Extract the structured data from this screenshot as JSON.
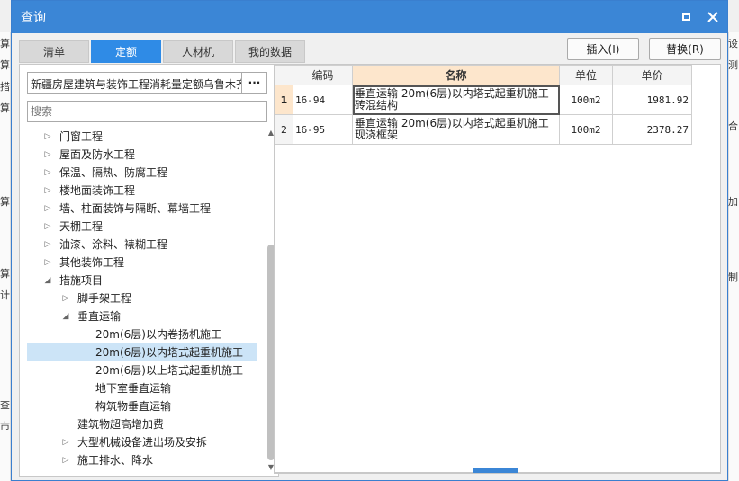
{
  "background": {
    "left_marks": [
      "算",
      "算",
      "措",
      "算",
      "算",
      "算",
      "计",
      "查",
      "市"
    ],
    "right_marks": [
      "设",
      "测",
      "合",
      "加",
      "制"
    ]
  },
  "window": {
    "title": "查询",
    "maximize_icon": "maximize-icon",
    "close_icon": "close-icon"
  },
  "tabs": [
    "清单",
    "定额",
    "人材机",
    "我的数据"
  ],
  "active_tab": "定额",
  "toolbar": {
    "insert_label": "插入(I)",
    "replace_label": "替换(R)"
  },
  "left": {
    "quota_db": "新疆房屋建筑与装饰工程消耗量定额乌鲁木齐",
    "more_label": "···",
    "search_placeholder": "搜索",
    "tree": [
      {
        "label": "门窗工程",
        "level": 1,
        "arrow": "right"
      },
      {
        "label": "屋面及防水工程",
        "level": 1,
        "arrow": "right"
      },
      {
        "label": "保温、隔热、防腐工程",
        "level": 1,
        "arrow": "right"
      },
      {
        "label": "楼地面装饰工程",
        "level": 1,
        "arrow": "right"
      },
      {
        "label": "墙、柱面装饰与隔断、幕墙工程",
        "level": 1,
        "arrow": "right"
      },
      {
        "label": "天棚工程",
        "level": 1,
        "arrow": "right"
      },
      {
        "label": "油漆、涂料、裱糊工程",
        "level": 1,
        "arrow": "right"
      },
      {
        "label": "其他装饰工程",
        "level": 1,
        "arrow": "right"
      },
      {
        "label": "措施项目",
        "level": 1,
        "arrow": "down"
      },
      {
        "label": "脚手架工程",
        "level": 2,
        "arrow": "right"
      },
      {
        "label": "垂直运输",
        "level": 2,
        "arrow": "down"
      },
      {
        "label": "20m(6层)以内卷扬机施工",
        "level": 3,
        "arrow": ""
      },
      {
        "label": "20m(6层)以内塔式起重机施工",
        "level": 3,
        "arrow": "",
        "selected": true
      },
      {
        "label": "20m(6层)以上塔式起重机施工",
        "level": 3,
        "arrow": ""
      },
      {
        "label": "地下室垂直运输",
        "level": 3,
        "arrow": ""
      },
      {
        "label": "构筑物垂直运输",
        "level": 3,
        "arrow": ""
      },
      {
        "label": "建筑物超高增加费",
        "level": 2,
        "arrow": ""
      },
      {
        "label": "大型机械设备进出场及安拆",
        "level": 2,
        "arrow": "right"
      },
      {
        "label": "施工排水、降水",
        "level": 2,
        "arrow": "right"
      }
    ]
  },
  "grid": {
    "headers": [
      "编码",
      "名称",
      "单位",
      "单价"
    ],
    "rows": [
      {
        "no": "1",
        "code": "16-94",
        "name": "垂直运输 20m(6层)以内塔式起重机施工\n砖混结构",
        "unit": "100m2",
        "price": "1981.92"
      },
      {
        "no": "2",
        "code": "16-95",
        "name": "垂直运输 20m(6层)以内塔式起重机施工\n现浇框架",
        "unit": "100m2",
        "price": "2378.27"
      }
    ]
  }
}
